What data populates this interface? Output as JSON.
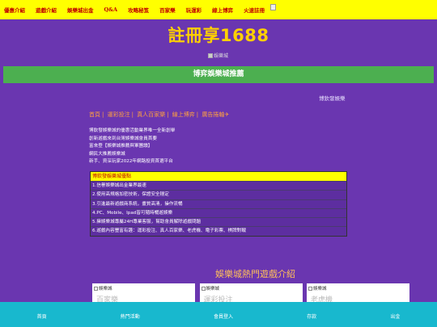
{
  "topnav": {
    "items": [
      "優惠介紹",
      "遊戲介紹",
      "娛樂城出金",
      "Q&A",
      "攻略秘笈",
      "百家樂",
      "玩運彩",
      "線上博弈",
      "火速註冊"
    ]
  },
  "logo": "註冊享1688",
  "banner_alt": "娛樂城",
  "green_bar": "博弈娛樂城推薦",
  "right_link": "博欽發娛樂",
  "breadcrumbs": [
    "首頁",
    "運彩投注",
    "真人百家樂",
    "線上博弈",
    "廣告捲軸✈"
  ],
  "intro": [
    "博欽發娛樂城的優惠活動業界唯一全新創舉",
    "創新遊戲來到台灣娛樂城會員首要",
    "富來登【娛樂城推薦與軍團讀】",
    "網民大推薦娛樂城",
    "新手、資深玩家2022年網路投資首選平台"
  ],
  "features": {
    "header": "博欽發娛樂城優點",
    "items": [
      "1.信譽娛樂城出金業界最速",
      "2.使用高規格加密技術，保證安全穩定",
      "3.引進最新遊戲商系統，畫質高清，操作流暢",
      "4.PC、Mobile、Ipad皆可隨時暢遊娛樂",
      "5.擁娛樂城專屬24H專業客服，幫助會員解除遊戲問題",
      "6.遊戲內容豐富有趣：運彩投注、真人百家樂、老虎機、電子彩票、棋牌對戰"
    ]
  },
  "section_title": "娛樂城熱門遊戲介紹",
  "cards": [
    {
      "alt": "娛樂城",
      "title": "百家樂"
    },
    {
      "alt": "娛樂城",
      "title": "運彩投注"
    },
    {
      "alt": "娛樂城",
      "title": "老虎機"
    }
  ],
  "footer": {
    "items": [
      "首頁",
      "熱門活動",
      "會員登入",
      "存款",
      "出金"
    ]
  }
}
